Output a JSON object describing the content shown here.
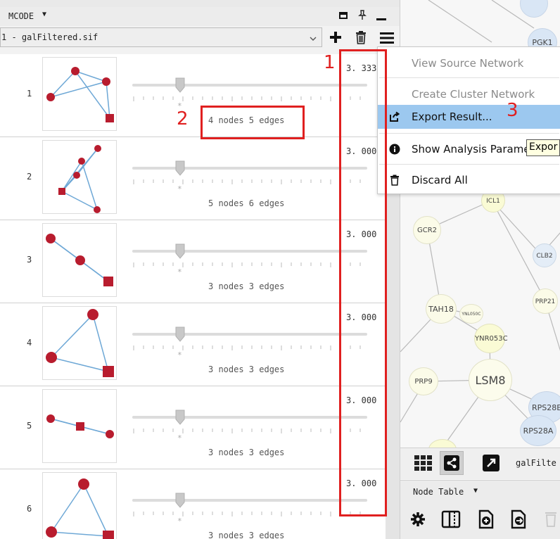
{
  "panel": {
    "title": "MCODE",
    "network_selector_value": "1 - galFiltered.sif"
  },
  "clusters": [
    {
      "rank": "1",
      "score": "3. 333",
      "nodes_edges": "4 nodes  5 edges"
    },
    {
      "rank": "2",
      "score": "3. 000",
      "nodes_edges": "5 nodes  6 edges"
    },
    {
      "rank": "3",
      "score": "3. 000",
      "nodes_edges": "3 nodes  3 edges"
    },
    {
      "rank": "4",
      "score": "3. 000",
      "nodes_edges": "3 nodes  3 edges"
    },
    {
      "rank": "5",
      "score": "3. 000",
      "nodes_edges": "3 nodes  3 edges"
    },
    {
      "rank": "6",
      "score": "3. 000",
      "nodes_edges": "3 nodes  3 edges"
    }
  ],
  "slider_star": "*",
  "context_menu": {
    "items": [
      {
        "label": "View Source Network",
        "enabled": false
      },
      {
        "label": "Create Cluster Network",
        "enabled": false
      },
      {
        "label": "Export Result...",
        "enabled": true,
        "highlighted": true
      },
      {
        "label": "Show Analysis Parame",
        "enabled": true
      },
      {
        "label": "Discard All",
        "enabled": true
      }
    ],
    "tooltip": "Expor"
  },
  "annotations": [
    "1",
    "2",
    "3"
  ],
  "network_view": {
    "nodes": [
      "PGK1",
      "ICL1",
      "GCR2",
      "CLB2",
      "PRP21",
      "TAH18",
      "YNL050C",
      "YNR053C",
      "PRP9",
      "LSM8",
      "RPS28E",
      "RPS28A"
    ],
    "toolbar_label": "galFilte"
  },
  "table_panel": {
    "title": "Node Table"
  },
  "colors": {
    "accent_red": "#e02020",
    "node_red": "#b81c2e",
    "edge_blue": "#6ea8d6",
    "menu_highlight": "#9cc8ef"
  }
}
